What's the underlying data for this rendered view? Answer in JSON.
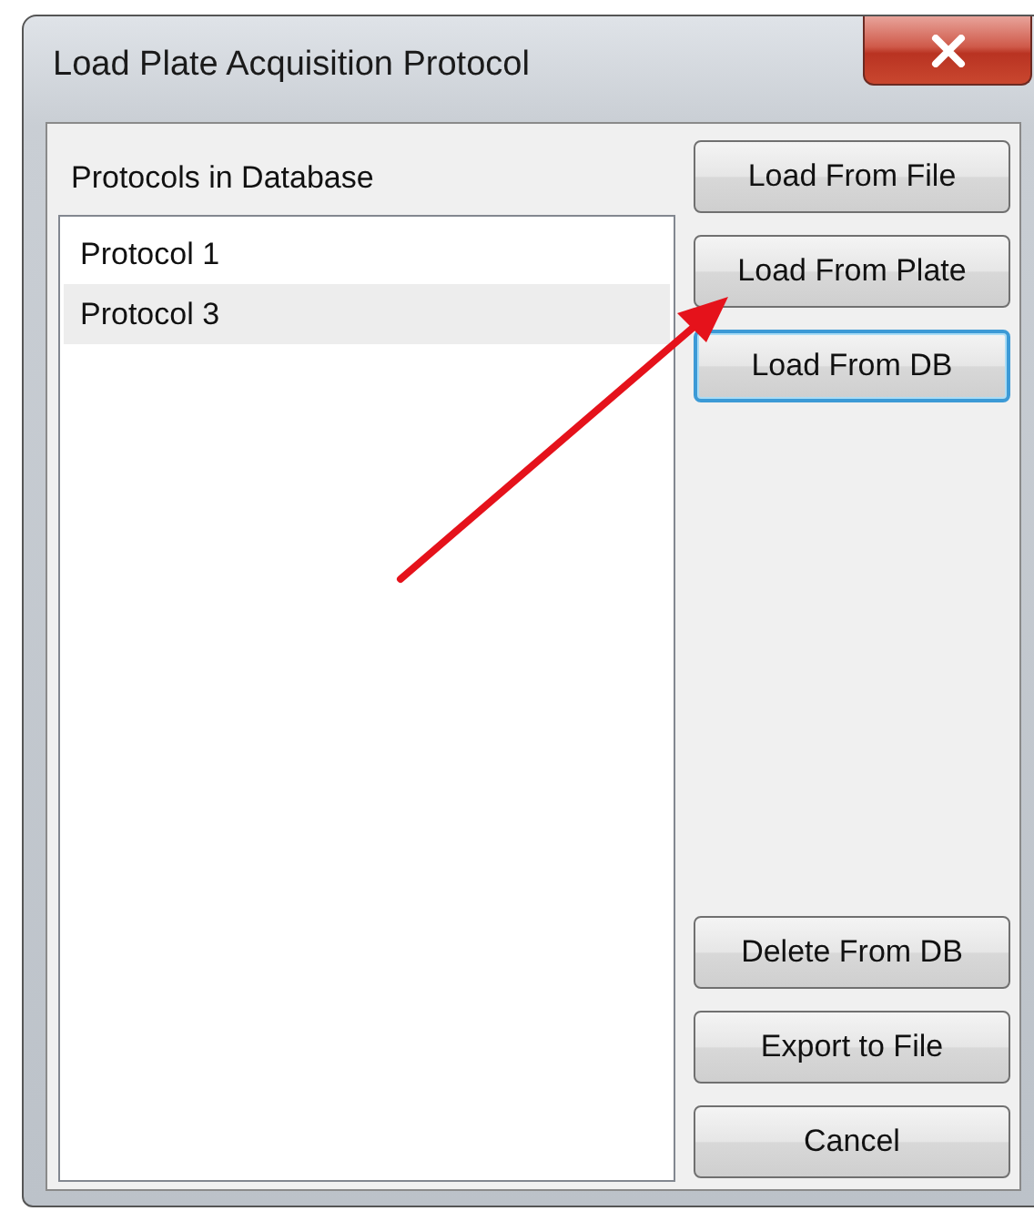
{
  "window": {
    "title": "Load Plate Acquisition Protocol"
  },
  "protocols": {
    "label": "Protocols in Database",
    "items": [
      {
        "name": "Protocol 1",
        "selected": false
      },
      {
        "name": "Protocol 3",
        "selected": true
      }
    ]
  },
  "top_buttons": [
    {
      "label": "Load From File",
      "focused": false
    },
    {
      "label": "Load From Plate",
      "focused": false
    },
    {
      "label": "Load From DB",
      "focused": true
    }
  ],
  "bottom_buttons": [
    {
      "label": "Delete From DB",
      "focused": false
    },
    {
      "label": "Export to File",
      "focused": false
    },
    {
      "label": "Cancel",
      "focused": false
    }
  ]
}
